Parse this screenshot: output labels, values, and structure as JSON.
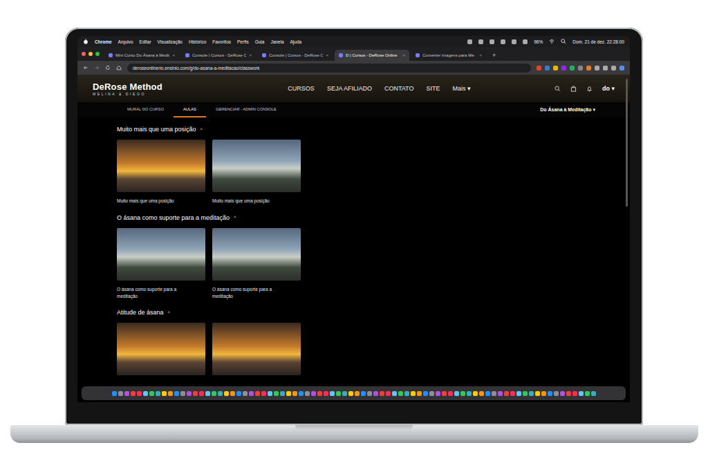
{
  "menubar": {
    "app": "Chrome",
    "items": [
      "Arquivo",
      "Editar",
      "Visualização",
      "Histórico",
      "Favoritos",
      "Perfis",
      "Guia",
      "Janela",
      "Ajuda"
    ],
    "battery": "96%",
    "clock": "Dom. 21 de dez.  22:28:00"
  },
  "tabs": [
    {
      "label": "Mini Curso Do Ásana à Medit",
      "selected": false
    },
    {
      "label": "Console | Cursos - DeRose O",
      "selected": false
    },
    {
      "label": "Console | Cursos - DeRose O",
      "selected": false
    },
    {
      "label": "D | Cursos - DeRose Online",
      "selected": true
    },
    {
      "label": "Converter imagens para We",
      "selected": false
    }
  ],
  "tab_close": "×",
  "new_tab": "+",
  "address_bar": {
    "url": "deroseonlinerio.ensinio.com/g/do-asana-a-meditacao/classwork"
  },
  "site": {
    "logo": "DeRose Method",
    "logo_sub": "MELINA & DIEGO",
    "nav": [
      "CURSOS",
      "SEJA AFILIADO",
      "CONTATO",
      "SITE",
      "Mais ▾"
    ],
    "avatar": "do ▾"
  },
  "subnav": {
    "tabs": [
      {
        "label": "MURAL DO CURSO",
        "selected": false
      },
      {
        "label": "AULAS",
        "selected": true
      },
      {
        "label": "GERENCIAR - ADMIN CONSOLE",
        "selected": false
      }
    ],
    "course_select": "Do Ásana à Meditação ▾"
  },
  "sections": [
    {
      "title": "Muito mais que uma posição",
      "toggle": "^",
      "expanded": true,
      "lessons": [
        {
          "caption": "Muito mais que uma posição",
          "kind": "sunset"
        },
        {
          "caption": "Muito mais que uma posição",
          "kind": "sky"
        }
      ]
    },
    {
      "title": "O ásana como suporte para a meditação",
      "toggle": "^",
      "expanded": true,
      "lessons": [
        {
          "caption": "O ásana como suporte para a meditação",
          "kind": "sky"
        },
        {
          "caption": "O ásana como suporte para a meditação",
          "kind": "sky"
        }
      ]
    },
    {
      "title": "Atitude de ásana",
      "toggle": "^",
      "expanded": true,
      "lessons": [
        {
          "kind": "sunset"
        },
        {
          "kind": "sunset"
        }
      ]
    }
  ]
}
